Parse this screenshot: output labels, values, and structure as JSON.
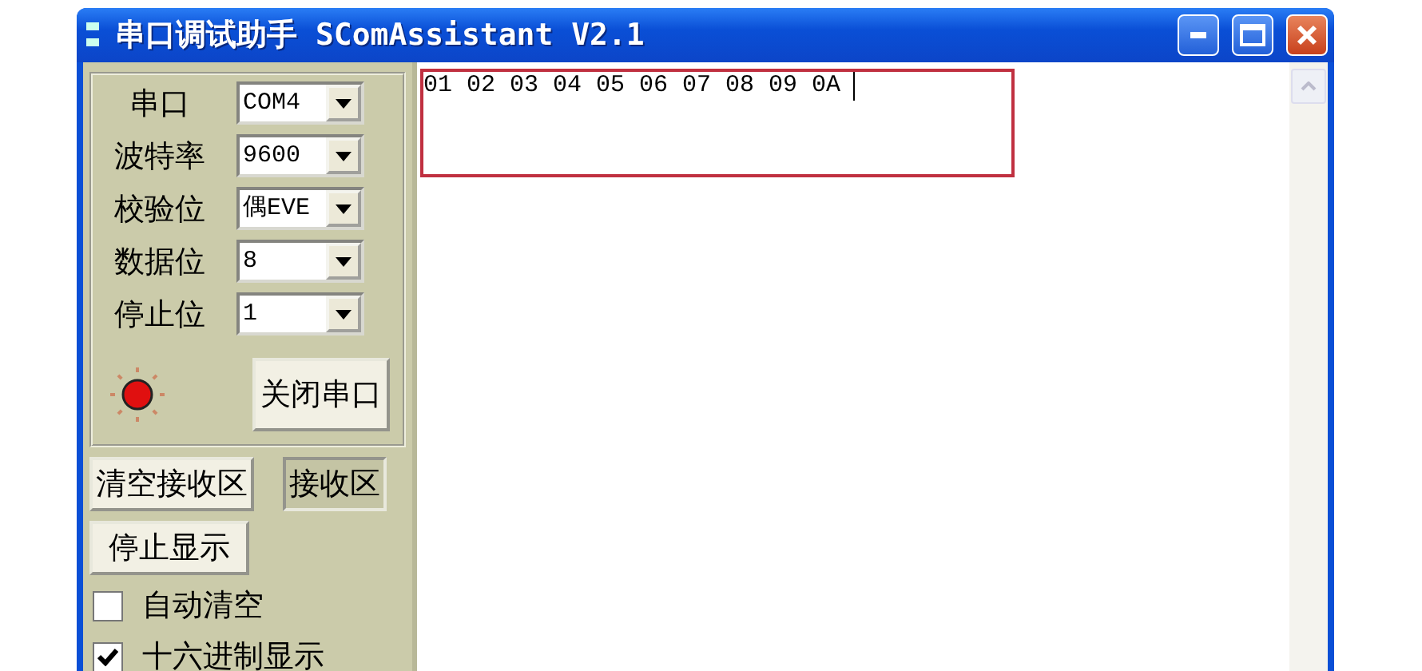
{
  "window": {
    "title": "串口调试助手 SComAssistant V2.1"
  },
  "settings": [
    {
      "label": "串口",
      "value": "COM4"
    },
    {
      "label": "波特率",
      "value": "9600"
    },
    {
      "label": "校验位",
      "value": "偶EVE"
    },
    {
      "label": "数据位",
      "value": "8"
    },
    {
      "label": "停止位",
      "value": "1"
    }
  ],
  "led": {
    "on": true
  },
  "port_button": "关闭串口",
  "buttons": [
    {
      "label": "清空接收区",
      "pressed": false
    },
    {
      "label": "接收区",
      "pressed": true
    },
    {
      "label": "停止显示",
      "pressed": false
    }
  ],
  "checkboxes": [
    {
      "label": "自动清空",
      "checked": false
    },
    {
      "label": "十六进制显示",
      "checked": true
    }
  ],
  "receive_area": {
    "text": "01 02 03 04 05 06 07 08 09 0A"
  }
}
